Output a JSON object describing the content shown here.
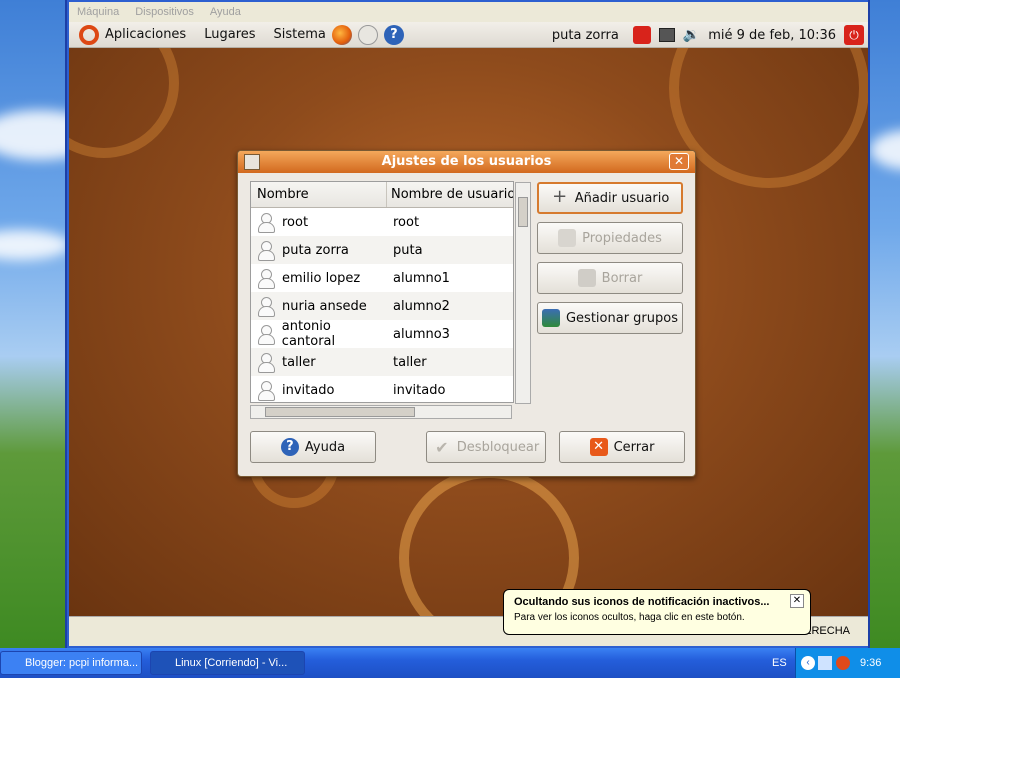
{
  "vbox_menu": [
    "Máquina",
    "Dispositivos",
    "Ayuda"
  ],
  "panel": {
    "menus": [
      "Aplicaciones",
      "Lugares",
      "Sistema"
    ],
    "user": "puta zorra",
    "clock": "mié  9 de feb, 10:36"
  },
  "dialog": {
    "title": "Ajustes de los usuarios",
    "columns": [
      "Nombre",
      "Nombre de usuario"
    ],
    "rows": [
      {
        "name": "root",
        "username": "root"
      },
      {
        "name": "puta zorra",
        "username": "puta"
      },
      {
        "name": "emilio lopez",
        "username": "alumno1"
      },
      {
        "name": "nuria ansede",
        "username": "alumno2"
      },
      {
        "name": "antonio cantoral",
        "username": "alumno3"
      },
      {
        "name": "taller",
        "username": "taller"
      },
      {
        "name": "invitado",
        "username": "invitado"
      }
    ],
    "buttons": {
      "add": "Añadir usuario",
      "properties": "Propiedades",
      "delete": "Borrar",
      "groups": "Gestionar grupos",
      "help": "Ayuda",
      "unlock": "Desbloquear",
      "close": "Cerrar"
    }
  },
  "balloon": {
    "title": "Ocultando sus iconos de notificación inactivos...",
    "text": "Para ver los iconos ocultos, haga clic en este botón."
  },
  "vbox_status": "DERECHA",
  "taskbar": {
    "tasks": [
      "Blogger: pcpi informa...",
      "Linux [Corriendo] - Vi..."
    ],
    "lang": "ES",
    "time": "9:36"
  }
}
